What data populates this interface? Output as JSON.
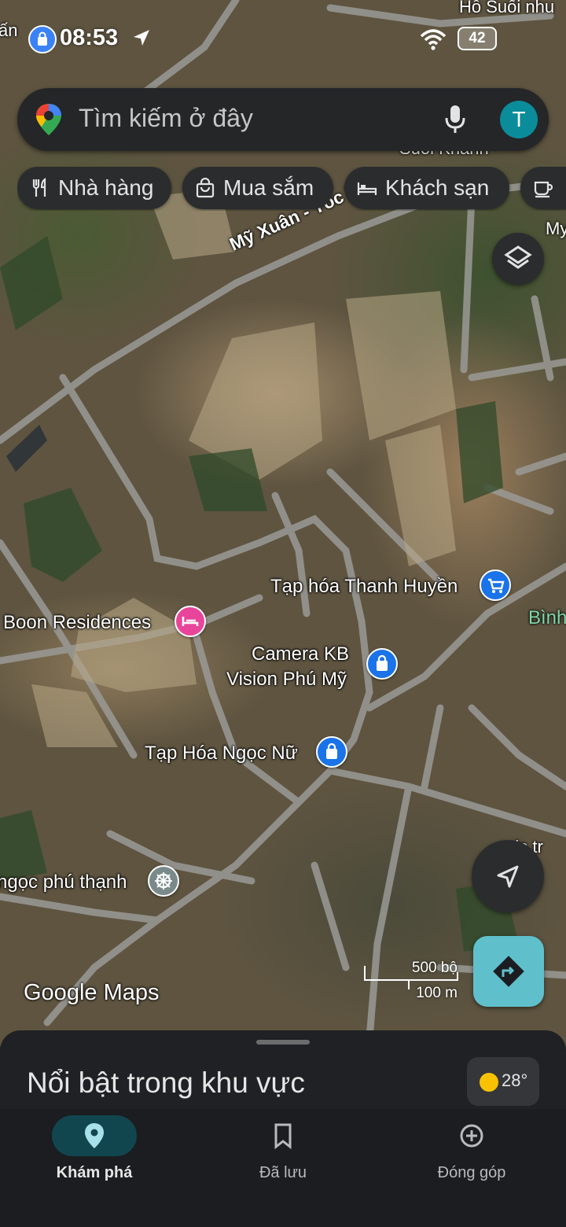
{
  "status_bar": {
    "time": "08:53",
    "battery": "42"
  },
  "search": {
    "placeholder": "Tìm kiếm ở đây",
    "avatar_initial": "T"
  },
  "chips": [
    {
      "label": "Nhà hàng",
      "icon": "fork-knife-icon"
    },
    {
      "label": "Mua sắm",
      "icon": "shopping-bag-icon"
    },
    {
      "label": "Khách sạn",
      "icon": "bed-icon"
    }
  ],
  "map": {
    "road_label": "Mỹ Xuân - Tóc Tiên",
    "edge_labels": [
      "ấn",
      "Hồ Suối nhu",
      "Suối Khanh",
      "My",
      "Bình",
      "ds tr"
    ],
    "pois": [
      {
        "name": "Tạp hóa Thanh Huyền",
        "icon": "shopping-cart-icon",
        "color": "#1a73e8"
      },
      {
        "name": "Boon Residences",
        "icon": "hotel-bed-icon",
        "color": "#e8459a"
      },
      {
        "name_lines": [
          "Camera KB",
          "Vision Phú Mỹ"
        ],
        "icon": "shopping-bag-icon",
        "color": "#1a73e8"
      },
      {
        "name": "Tạp Hóa Ngọc Nữ",
        "icon": "shopping-bag-icon",
        "color": "#1a73e8"
      },
      {
        "name": "ngọc phú thạnh",
        "icon": "wheel-icon",
        "color": "#7a8a8a"
      }
    ],
    "attribution": "Google Maps",
    "scale": {
      "imperial": "500 bộ",
      "metric": "100 m"
    }
  },
  "sheet": {
    "title": "Nổi bật trong khu vực",
    "temperature": "28°"
  },
  "nav": [
    {
      "label": "Khám phá",
      "icon": "explore-pin-icon",
      "active": true
    },
    {
      "label": "Đã lưu",
      "icon": "bookmark-icon",
      "active": false
    },
    {
      "label": "Đóng góp",
      "icon": "add-circle-icon",
      "active": false
    }
  ]
}
